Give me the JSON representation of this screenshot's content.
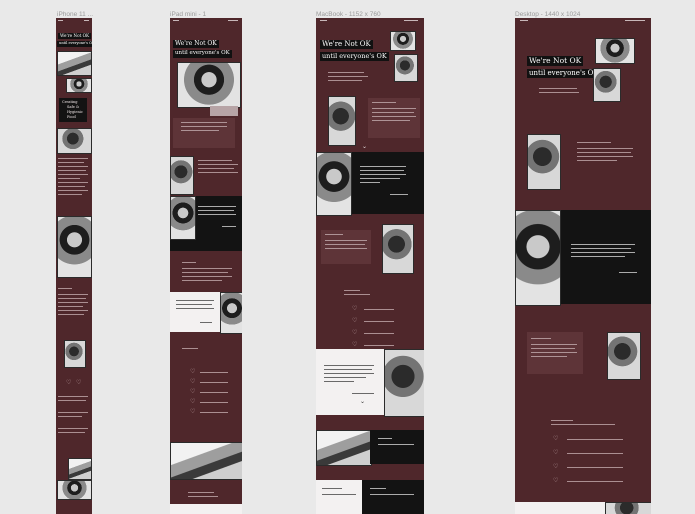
{
  "frames": [
    {
      "label": "iPhone 11 ..."
    },
    {
      "label": "iPad mini - 1"
    },
    {
      "label": "MacBook - 1152 x 760"
    },
    {
      "label": "Desktop - 1440 x 1024"
    }
  ],
  "hero": {
    "line1": "We're Not OK",
    "line2": "until everyone's OK"
  },
  "phone_quote": [
    "Creating",
    "Safe &",
    "Hygienic",
    "Food"
  ],
  "quote_author": "- Buddha quote Tasthu",
  "colors": {
    "canvas": "#e9e9e9",
    "maroon": "#4f272b",
    "black_panel": "#131313",
    "white_panel": "#f3f1f1"
  },
  "icons": [
    "heart-icon",
    "chevron-down-icon"
  ]
}
